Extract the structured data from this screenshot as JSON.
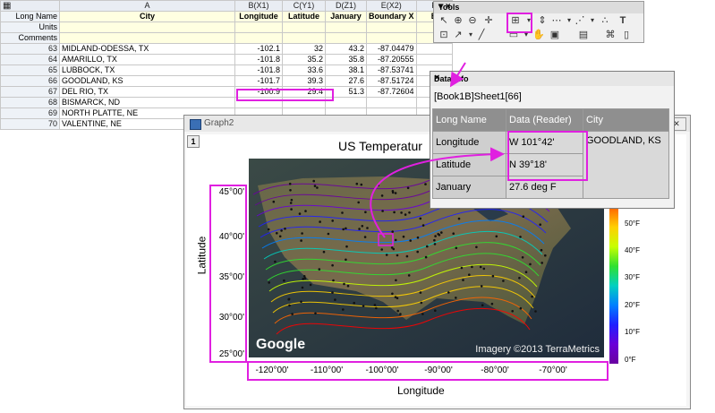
{
  "spreadsheet": {
    "corner_icon": "grid-icon",
    "columns": [
      "A",
      "B(X1)",
      "C(Y1)",
      "D(Z1)",
      "E(X2)",
      "F"
    ],
    "long_names": [
      "City",
      "Longitude",
      "Latitude",
      "January",
      "Boundary X",
      "B"
    ],
    "meta_labels": [
      "Long Name",
      "Units",
      "Comments"
    ],
    "rows": [
      {
        "n": "63",
        "city": "MIDLAND-ODESSA, TX",
        "lon": "-102.1",
        "lat": "32",
        "jan": "43.2",
        "bx": "-87.04479"
      },
      {
        "n": "64",
        "city": "AMARILLO, TX",
        "lon": "-101.8",
        "lat": "35.2",
        "jan": "35.8",
        "bx": "-87.20555"
      },
      {
        "n": "65",
        "city": "LUBBOCK, TX",
        "lon": "-101.8",
        "lat": "33.6",
        "jan": "38.1",
        "bx": "-87.53741"
      },
      {
        "n": "66",
        "city": "GOODLAND, KS",
        "lon": "-101.7",
        "lat": "39.3",
        "jan": "27.6",
        "bx": "-87.51724"
      },
      {
        "n": "67",
        "city": "DEL RIO, TX",
        "lon": "-100.9",
        "lat": "29.4",
        "jan": "51.3",
        "bx": "-87.72604"
      },
      {
        "n": "68",
        "city": "BISMARCK, ND",
        "lon": "",
        "lat": "",
        "jan": "",
        "bx": ""
      },
      {
        "n": "69",
        "city": "NORTH PLATTE, NE",
        "lon": "",
        "lat": "",
        "jan": "",
        "bx": ""
      },
      {
        "n": "70",
        "city": "VALENTINE, NE",
        "lon": "",
        "lat": "",
        "jan": "",
        "bx": ""
      }
    ]
  },
  "tools": {
    "title": "Tools",
    "controls": "▾ ×"
  },
  "graph": {
    "window_title": "Graph2",
    "layer": "1",
    "chart_title": "US Temperatur",
    "xlabel": "Longitude",
    "ylabel": "Latitude",
    "xticks": [
      "-120°00'",
      "-110°00'",
      "-100°00'",
      "-90°00'",
      "-80°00'",
      "-70°00'"
    ],
    "yticks": [
      "45°00'",
      "40°00'",
      "35°00'",
      "30°00'",
      "25°00'"
    ],
    "map_brand": "Google",
    "map_credit": "Imagery ©2013 TerraMetrics",
    "colorbar_labels": [
      "50°F",
      "40°F",
      "30°F",
      "20°F",
      "10°F",
      "0°F"
    ],
    "colorbar_colors": [
      "#ff0000",
      "#ff6600",
      "#ffd000",
      "#c8ff00",
      "#30e030",
      "#00d0c0",
      "#0080ff",
      "#2020ff",
      "#6a00d8",
      "#6a00a0"
    ],
    "close_label": "✕"
  },
  "datainfo": {
    "title": "Data Info",
    "close": "×",
    "source": "[Book1B]Sheet1[66]",
    "headers": [
      "Long Name",
      "Data (Reader)",
      "City"
    ],
    "rows": [
      {
        "name": "Longitude",
        "value": "W 101°42'"
      },
      {
        "name": "Latitude",
        "value": "N 39°18'"
      },
      {
        "name": "January",
        "value": "27.6 deg F"
      }
    ],
    "city": "GOODLAND, KS"
  },
  "accent": "#e020e0"
}
